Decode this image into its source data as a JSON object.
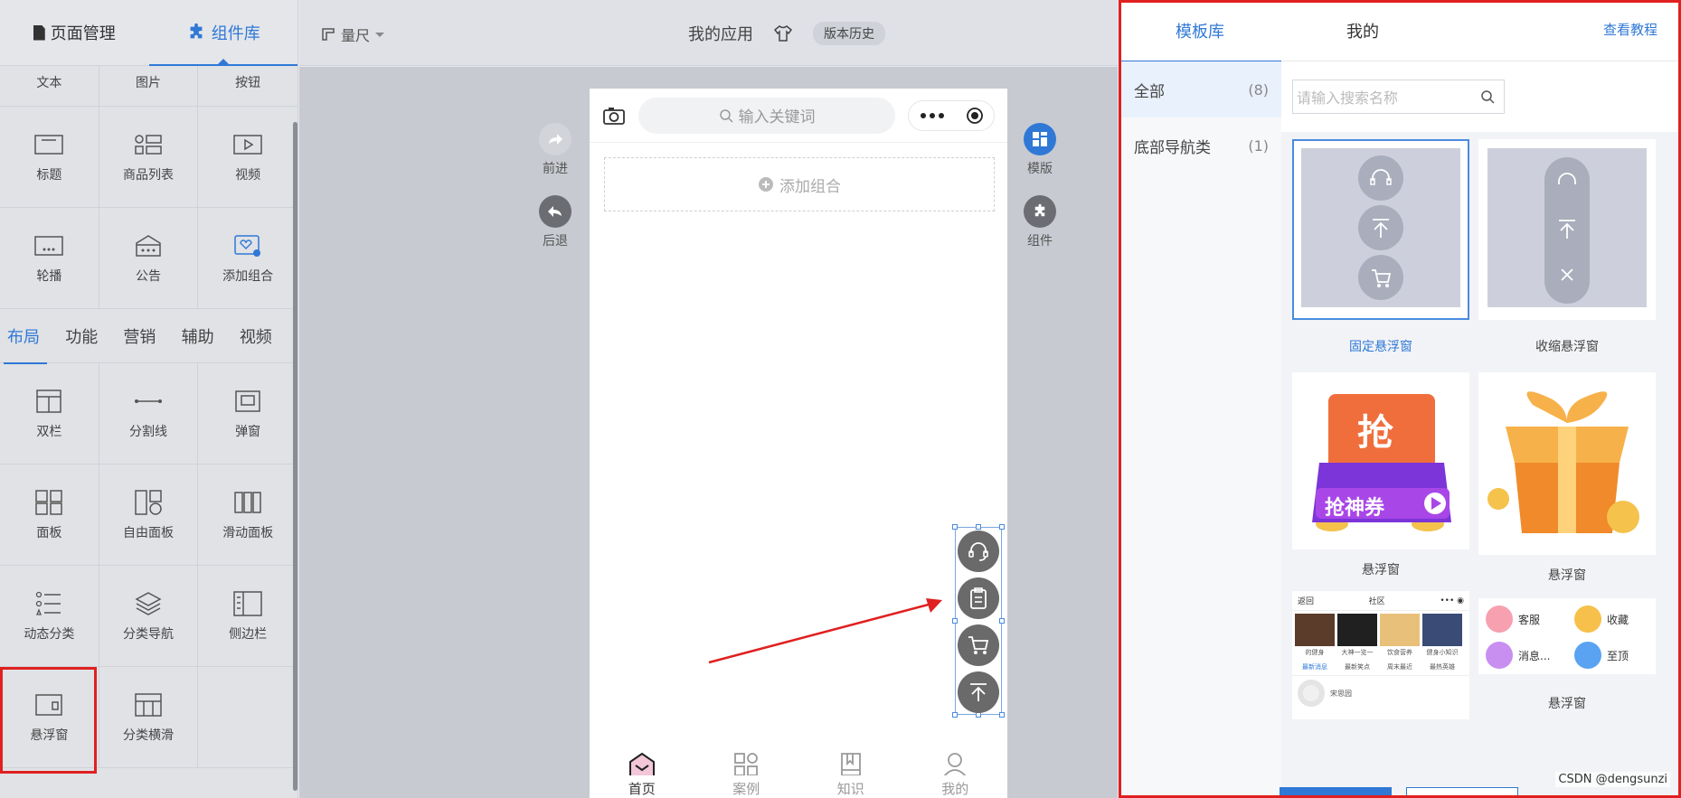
{
  "left_panel": {
    "tabs": [
      {
        "label": "页面管理",
        "icon": "page-icon"
      },
      {
        "label": "组件库",
        "icon": "puzzle-icon"
      }
    ],
    "top_row": [
      "文本",
      "图片",
      "按钮"
    ],
    "rows1": [
      [
        {
          "label": "标题",
          "icon": "title-icon"
        },
        {
          "label": "商品列表",
          "icon": "product-list-icon"
        },
        {
          "label": "视频",
          "icon": "video-icon"
        }
      ],
      [
        {
          "label": "轮播",
          "icon": "carousel-icon"
        },
        {
          "label": "公告",
          "icon": "notice-icon"
        },
        {
          "label": "添加组合",
          "icon": "add-combo-icon"
        }
      ]
    ],
    "category_tabs": [
      "布局",
      "功能",
      "营销",
      "辅助",
      "视频"
    ],
    "rows2": [
      [
        {
          "label": "双栏",
          "icon": "two-column-icon"
        },
        {
          "label": "分割线",
          "icon": "divider-icon"
        },
        {
          "label": "弹窗",
          "icon": "popup-icon"
        }
      ],
      [
        {
          "label": "面板",
          "icon": "panel-icon"
        },
        {
          "label": "自由面板",
          "icon": "free-panel-icon"
        },
        {
          "label": "滑动面板",
          "icon": "slide-panel-icon"
        }
      ],
      [
        {
          "label": "动态分类",
          "icon": "dynamic-category-icon"
        },
        {
          "label": "分类导航",
          "icon": "category-nav-icon"
        },
        {
          "label": "侧边栏",
          "icon": "sidebar-icon"
        }
      ],
      [
        {
          "label": "悬浮窗",
          "icon": "float-window-icon"
        },
        {
          "label": "分类横滑",
          "icon": "category-swipe-icon"
        }
      ]
    ]
  },
  "topbar": {
    "ruler": "量尺",
    "app_name": "我的应用",
    "version_history": "版本历史"
  },
  "canvas": {
    "forward": "前进",
    "back": "后退",
    "template": "模版",
    "component": "组件"
  },
  "phone": {
    "search_placeholder": "输入关键词",
    "add_group": "添加组合",
    "tabbar": [
      "首页",
      "案例",
      "知识",
      "我的"
    ]
  },
  "right_panel": {
    "tabs": [
      "模板库",
      "我的"
    ],
    "tutorial_link": "查看教程",
    "categories": [
      {
        "label": "全部",
        "count": "(8)"
      },
      {
        "label": "底部导航类",
        "count": "(1)"
      }
    ],
    "search_placeholder": "请输入搜索名称",
    "templates": [
      {
        "label": "固定悬浮窗"
      },
      {
        "label": "收缩悬浮窗"
      },
      {
        "label": "悬浮窗",
        "badge_main": "抢",
        "badge_sub": "抢神券"
      },
      {
        "label": "悬浮窗"
      },
      {
        "label": "",
        "preview": {
          "back": "返回",
          "title": "社区",
          "items": [
            "的健身",
            "大神一览一",
            "饮食营养",
            "健身小知识"
          ],
          "tabs": [
            "最新消息",
            "最新笑点",
            "周末最近",
            "最热英雄"
          ],
          "user": "宋思园"
        }
      },
      {
        "label": "悬浮窗",
        "preview": {
          "items": [
            "客服",
            "收藏",
            "消息...",
            "至顶"
          ]
        }
      }
    ]
  },
  "watermark": "CSDN @dengsunzi",
  "colors": {
    "accent": "#2f78d6",
    "highlight": "#e02020"
  }
}
